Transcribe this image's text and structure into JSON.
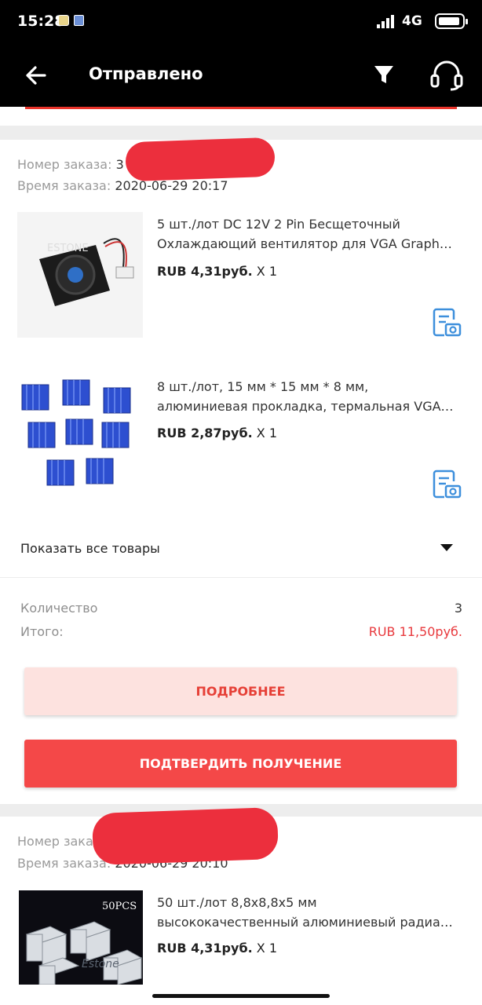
{
  "status_bar": {
    "time": "15:28",
    "network": "4G"
  },
  "header": {
    "title": "Отправлено"
  },
  "orders": [
    {
      "number_label": "Номер заказа:",
      "number_value": "3",
      "time_label": "Время заказа:",
      "time_value": "2020-06-29 20:17",
      "items": [
        {
          "title_line1": "5 шт./лот DC 12V 2 Pin Бесщеточный",
          "title_line2": "Охлаждающий вентилятор для VGA Graph…",
          "price": "RUB 4,31руб.",
          "qty": "X 1",
          "image_text": "ESTONE"
        },
        {
          "title_line1": "8 шт./лот, 15 мм * 15 мм * 8 мм,",
          "title_line2": "алюминиевая прокладка, термальная VGA…",
          "price": "RUB 2,87руб.",
          "qty": "X 1"
        }
      ],
      "show_all_label": "Показать все товары",
      "quantity_label": "Количество",
      "quantity_value": "3",
      "total_label": "Итого:",
      "total_value": "RUB 11,50руб.",
      "details_button": "ПОДРОБНЕЕ",
      "confirm_button": "ПОДТВЕРДИТЬ ПОЛУЧЕНИЕ"
    },
    {
      "number_label": "Номер заказа:",
      "time_label": "Время заказа:",
      "time_value": "2020-06-29 20:10",
      "items": [
        {
          "title_line1": "50 шт./лот 8,8х8,8х5 мм",
          "title_line2": "высококачественный алюминиевый радиа…",
          "price": "RUB 4,31руб.",
          "qty": "X 1",
          "image_badge": "50PCS",
          "image_text": "Estone"
        }
      ]
    }
  ],
  "colors": {
    "accent": "#f44848",
    "total": "#e8393d",
    "icon_blue": "#3d8fdc"
  }
}
